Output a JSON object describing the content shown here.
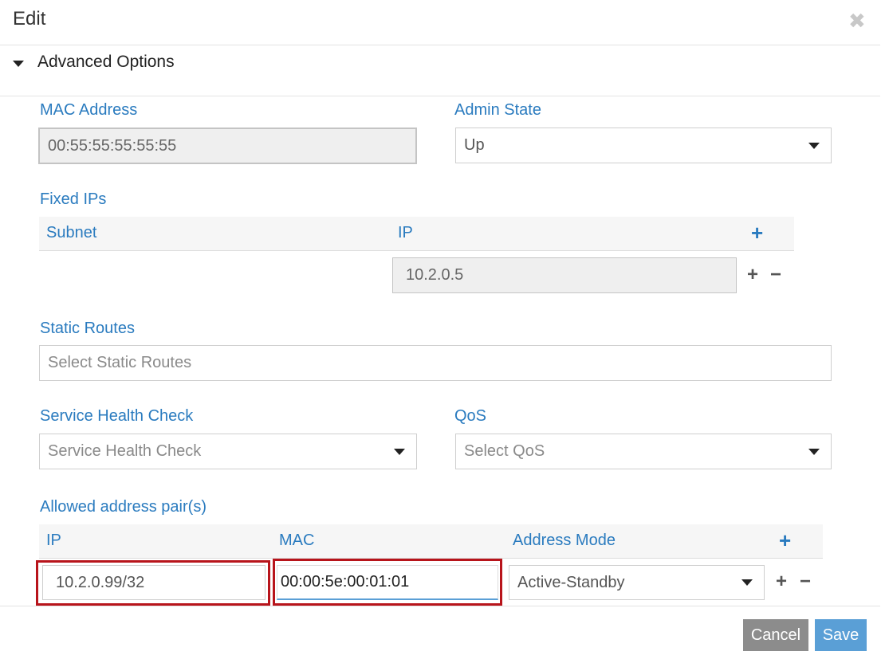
{
  "dialog": {
    "title": "Edit",
    "close_glyph": "✖"
  },
  "advanced": {
    "label": "Advanced Options"
  },
  "mac_address": {
    "label": "MAC Address",
    "value": "00:55:55:55:55:55"
  },
  "admin_state": {
    "label": "Admin State",
    "value": "Up"
  },
  "fixed_ips": {
    "label": "Fixed IPs",
    "columns": [
      "Subnet",
      "IP"
    ],
    "rows": [
      {
        "subnet": "",
        "ip": "10.2.0.5"
      }
    ]
  },
  "static_routes": {
    "label": "Static Routes",
    "placeholder": "Select Static Routes"
  },
  "service_health_check": {
    "label": "Service Health Check",
    "placeholder": "Service Health Check"
  },
  "qos": {
    "label": "QoS",
    "placeholder": "Select QoS"
  },
  "allowed_address_pairs": {
    "label": "Allowed address pair(s)",
    "columns": [
      "IP",
      "MAC",
      "Address Mode"
    ],
    "rows": [
      {
        "ip": "10.2.0.99/32",
        "mac": "00:00:5e:00:01:01",
        "mode": "Active-Standby"
      }
    ]
  },
  "glyphs": {
    "plus": "+",
    "minus": "−"
  },
  "footer": {
    "cancel_label": "Cancel",
    "save_label": "Save"
  },
  "colors": {
    "label_blue": "#2a7bbf",
    "highlight_red": "#b8141b",
    "save_blue": "#5a9fd6",
    "cancel_gray": "#8c8c8c"
  }
}
